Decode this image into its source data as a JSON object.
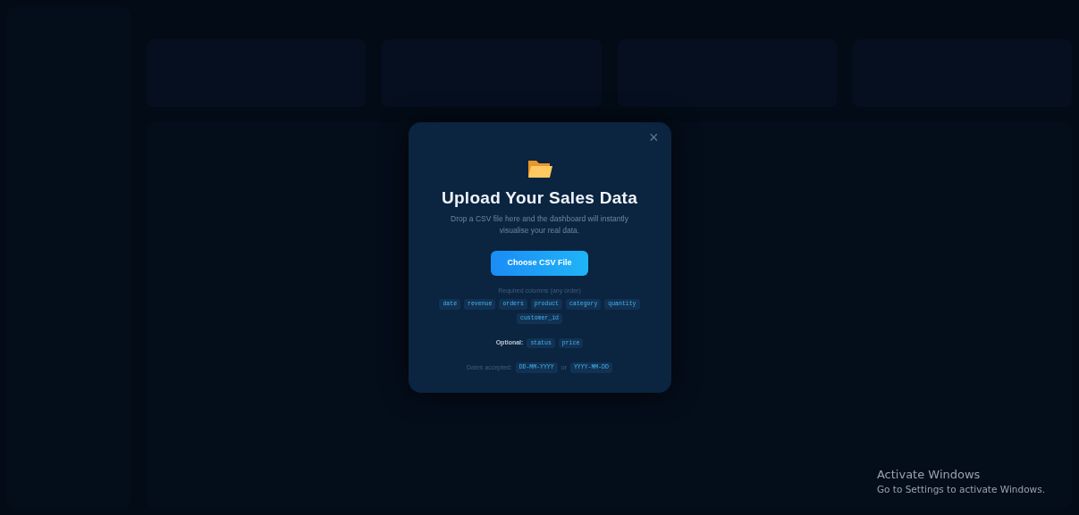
{
  "dialog": {
    "title": "Upload Your Sales Data",
    "description": "Drop a CSV file here and the dashboard will instantly visualise your real data.",
    "button": "Choose CSV File",
    "close": "×",
    "required_label": "Required columns (any order)",
    "required_columns": [
      "date",
      "revenue",
      "orders",
      "product",
      "category",
      "quantity",
      "customer_id"
    ],
    "optional_label": "Optional:",
    "optional_columns": [
      "status",
      "price"
    ],
    "dates_label": "Dates accepted:",
    "date_formats": [
      "DD-MM-YYYY",
      "YYYY-MM-DD"
    ],
    "dates_separator": "or"
  },
  "os_notice": {
    "title": "Activate Windows",
    "text": "Go to Settings to activate Windows."
  }
}
